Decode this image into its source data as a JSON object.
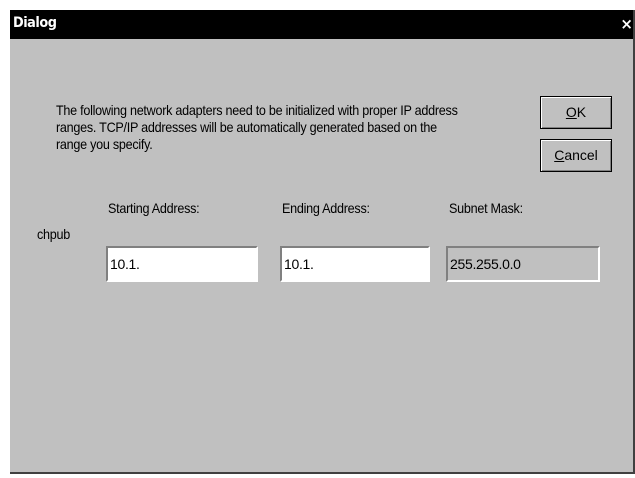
{
  "window": {
    "title": "Dialog",
    "close_glyph": "×"
  },
  "description": {
    "lines": [
      "The following network adapters need to be initialized with proper IP address",
      "ranges.  TCP/IP addresses will be automatically  generated based on the",
      "range you specify."
    ]
  },
  "buttons": {
    "ok_mnemonic": "O",
    "ok_rest": "K",
    "cancel_mnemonic": "C",
    "cancel_rest": "ancel"
  },
  "columns": {
    "starting_label": "Starting Address:",
    "ending_label": "Ending Address:",
    "subnet_label": "Subnet Mask:"
  },
  "adapter": {
    "name": "chpub",
    "starting_address": "10.1.",
    "ending_address": "10.1.",
    "subnet_mask": "255.255.0.0"
  },
  "colors": {
    "face": "#c0c0c0",
    "titlebar": "#000000",
    "field_bg": "#ffffff"
  }
}
